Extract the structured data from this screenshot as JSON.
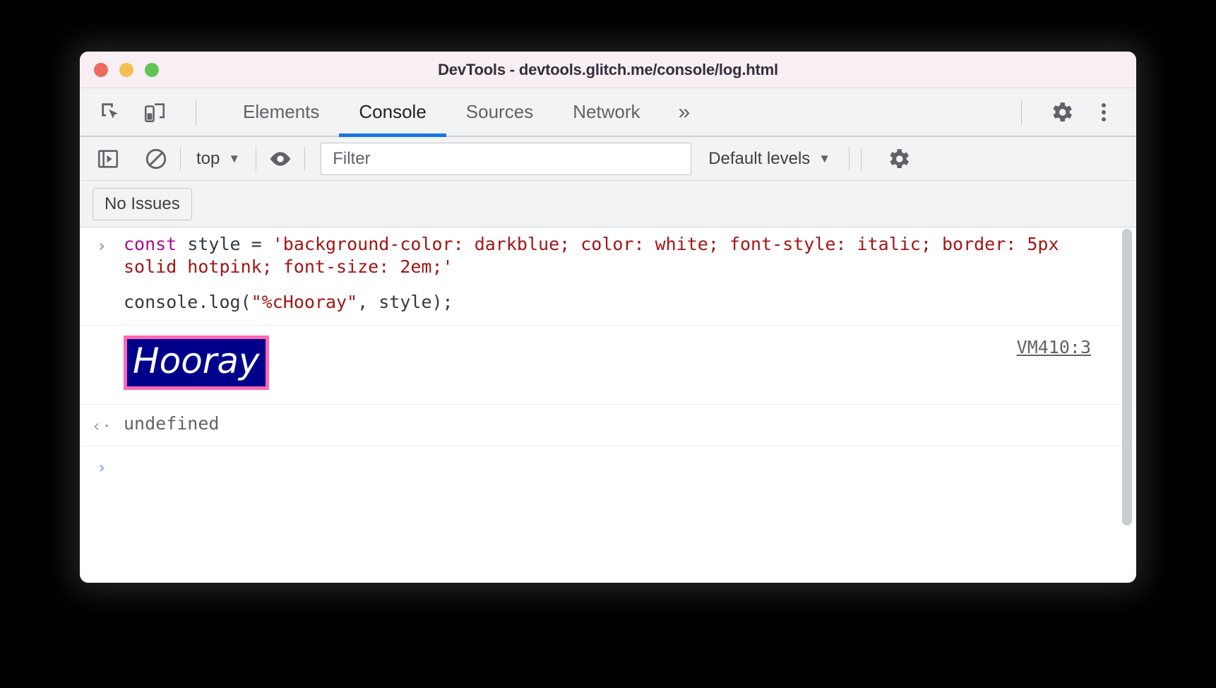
{
  "window": {
    "title": "DevTools - devtools.glitch.me/console/log.html",
    "traffic_lights": [
      {
        "name": "close",
        "color": "#ec6a5f"
      },
      {
        "name": "minimize",
        "color": "#f4bf50"
      },
      {
        "name": "maximize",
        "color": "#61c554"
      }
    ]
  },
  "tabbar": {
    "left_icons": [
      {
        "name": "inspect-element-icon",
        "label": "Inspect element"
      },
      {
        "name": "device-toolbar-icon",
        "label": "Toggle device toolbar"
      }
    ],
    "tabs": [
      {
        "label": "Elements",
        "active": false
      },
      {
        "label": "Console",
        "active": true
      },
      {
        "label": "Sources",
        "active": false
      },
      {
        "label": "Network",
        "active": false
      }
    ],
    "more_tabs": "»",
    "right_icons": [
      {
        "name": "settings-gear-icon",
        "label": "Settings"
      },
      {
        "name": "more-options-kebab-icon",
        "label": "Customize and control DevTools"
      }
    ],
    "active_underline_color": "#1a73e8"
  },
  "console_toolbar": {
    "sidebar_toggle": {
      "name": "console-sidebar-icon",
      "label": "Show console sidebar"
    },
    "clear_console": {
      "name": "clear-console-icon",
      "label": "Clear console"
    },
    "context_selector": {
      "value": "top",
      "caret": "▼"
    },
    "live_expression": {
      "name": "eye-icon",
      "label": "Create live expression"
    },
    "filter": {
      "value": "",
      "placeholder": "Filter"
    },
    "levels": {
      "value": "Default levels",
      "caret": "▼"
    },
    "settings": {
      "name": "console-settings-gear-icon",
      "label": "Console settings"
    }
  },
  "issues_bar": {
    "button_label": "No Issues"
  },
  "console": {
    "entries": [
      {
        "type": "input",
        "gutter": "›",
        "line1": {
          "keyword": "const",
          "mid": " style = ",
          "string": "'background-color: darkblue; color: white; font-style: italic; border: 5px solid hotpink; font-size: 2em;'"
        },
        "line2_before": "console.log(",
        "line2_string": "\"%cHooray\"",
        "line2_after": ", style);"
      },
      {
        "type": "output",
        "text": "Hooray",
        "source": "VM410:3",
        "styles": {
          "background_color": "darkblue",
          "background_hex": "#00008b",
          "color": "white",
          "font_style": "italic",
          "border": "5px solid hotpink",
          "border_hex": "#ff69b4",
          "font_size": "2em"
        }
      },
      {
        "type": "result",
        "gutter": "‹·",
        "text": "undefined"
      },
      {
        "type": "prompt",
        "gutter": "›",
        "text": ""
      }
    ]
  }
}
